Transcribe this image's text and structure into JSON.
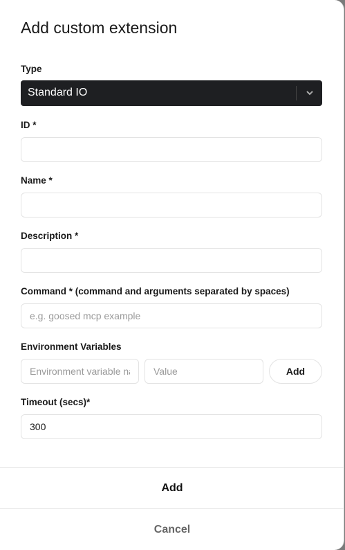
{
  "dialog": {
    "title": "Add custom extension"
  },
  "type": {
    "label": "Type",
    "value": "Standard IO"
  },
  "id": {
    "label": "ID *",
    "value": ""
  },
  "name": {
    "label": "Name *",
    "value": ""
  },
  "description": {
    "label": "Description *",
    "value": ""
  },
  "command": {
    "label": "Command * (command and arguments separated by spaces)",
    "placeholder": "e.g. goosed mcp example"
  },
  "env": {
    "label": "Environment Variables",
    "name_placeholder": "Environment variable name",
    "value_placeholder": "Value",
    "add_label": "Add"
  },
  "timeout": {
    "label": "Timeout (secs)*",
    "value": "300"
  },
  "footer": {
    "add_label": "Add",
    "cancel_label": "Cancel"
  }
}
